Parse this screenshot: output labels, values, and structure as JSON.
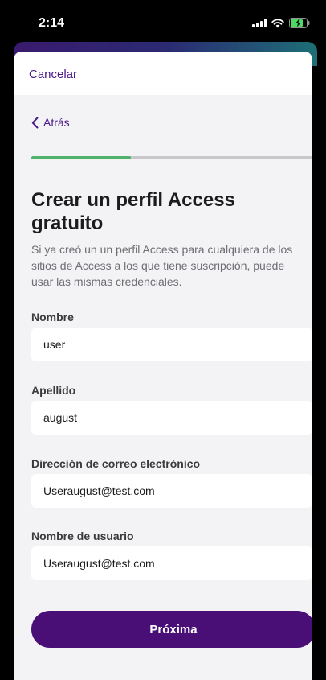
{
  "status_bar": {
    "time": "2:14"
  },
  "header": {
    "cancel_label": "Cancelar"
  },
  "nav": {
    "back_label": "Atrás"
  },
  "progress": {
    "fraction": 0.35,
    "fill_color": "#4fb36a",
    "track_color": "#c8c8ca"
  },
  "page": {
    "title": "Crear un perfil Access gratuito",
    "description": "Si ya creó un un perfil Access para cualquiera de los sitios de Access a los que tiene suscripción, puede usar las mismas credenciales."
  },
  "form": {
    "first_name": {
      "label": "Nombre",
      "value": "user"
    },
    "last_name": {
      "label": "Apellido",
      "value": "august"
    },
    "email": {
      "label": "Dirección de correo electrónico",
      "value": "Useraugust@test.com"
    },
    "username": {
      "label": "Nombre de usuario",
      "value": "Useraugust@test.com"
    }
  },
  "actions": {
    "next_label": "Próxima"
  },
  "colors": {
    "accent": "#4a0f77",
    "link": "#4b1a8a",
    "background": "#f3f2f5"
  },
  "icons": [
    "signal-icon",
    "wifi-icon",
    "battery-charging-icon",
    "chevron-left-icon"
  ]
}
